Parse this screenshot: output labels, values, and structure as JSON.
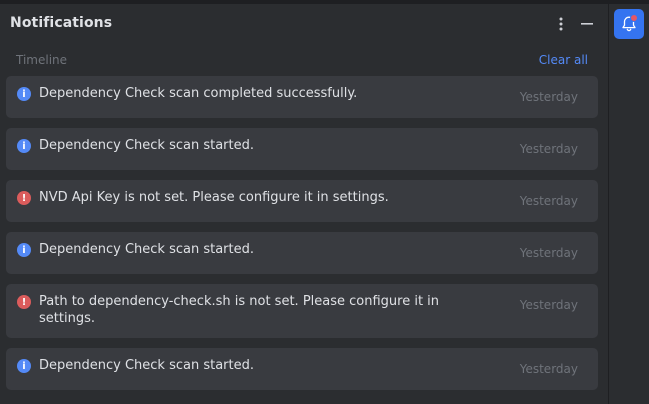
{
  "panel": {
    "title": "Notifications",
    "timeline_label": "Timeline",
    "clear_all_label": "Clear all"
  },
  "notifications": [
    {
      "type": "info",
      "text": "Dependency Check scan completed successfully.",
      "time": "Yesterday"
    },
    {
      "type": "info",
      "text": "Dependency Check scan started.",
      "time": "Yesterday"
    },
    {
      "type": "error",
      "text": "NVD Api Key is not set. Please configure it in settings.",
      "time": "Yesterday"
    },
    {
      "type": "info",
      "text": "Dependency Check scan started.",
      "time": "Yesterday"
    },
    {
      "type": "error",
      "text": "Path to dependency-check.sh is not set. Please configure it in settings.",
      "time": "Yesterday"
    },
    {
      "type": "info",
      "text": "Dependency Check scan started.",
      "time": "Yesterday"
    }
  ],
  "icons": {
    "info": "info-icon",
    "error": "error-icon",
    "more": "more-vertical-icon",
    "minimize": "minimize-icon",
    "bell": "bell-icon"
  },
  "colors": {
    "background": "#2b2d30",
    "card": "#393b40",
    "accent": "#548af7",
    "error": "#db5c5c",
    "bell_button": "#3574f0",
    "badge": "#e55765"
  }
}
